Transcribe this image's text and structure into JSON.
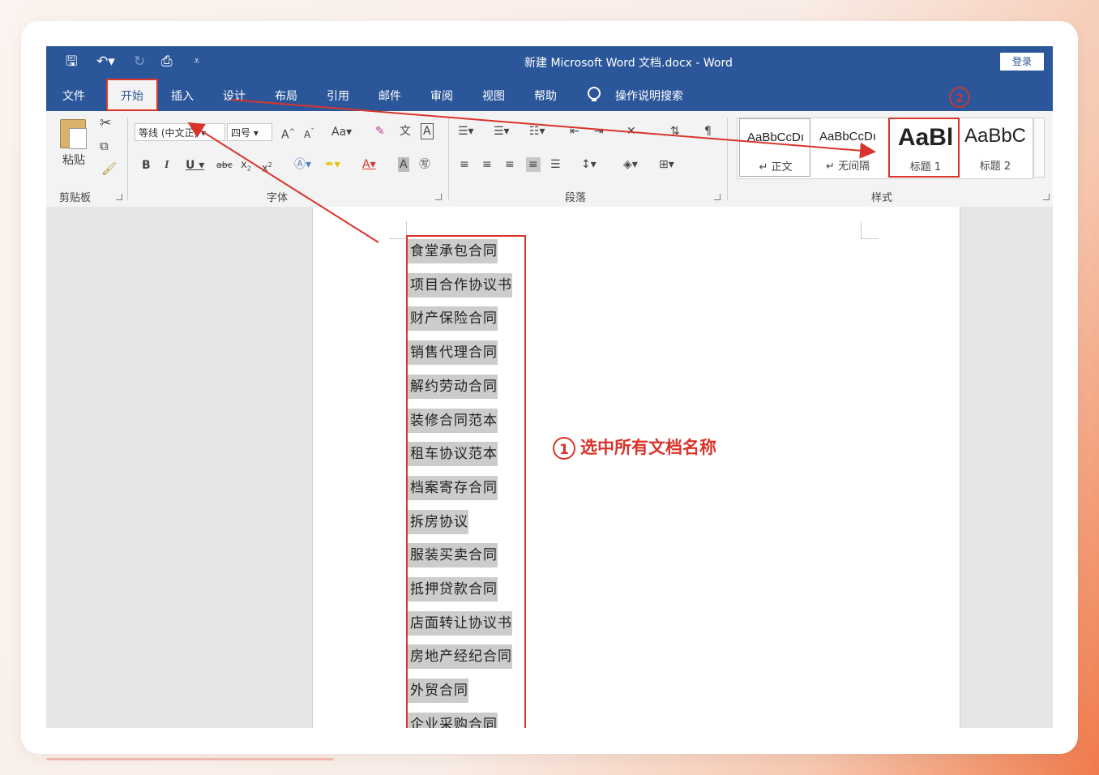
{
  "window": {
    "title": "新建 Microsoft Word 文档.docx  -  Word",
    "login": "登录"
  },
  "tabs": [
    "文件",
    "开始",
    "插入",
    "设计",
    "布局",
    "引用",
    "邮件",
    "审阅",
    "视图",
    "帮助"
  ],
  "tell_me": "操作说明搜索",
  "ribbon": {
    "clipboard": {
      "paste": "粘贴",
      "label": "剪贴板"
    },
    "font": {
      "font_name": "等线 (中文正)",
      "font_size": "四号",
      "label": "字体",
      "change_case": "Aa"
    },
    "paragraph": {
      "label": "段落"
    },
    "styles": {
      "label": "样式",
      "items": [
        {
          "preview": "AaBbCcDı",
          "name": "↵ 正文"
        },
        {
          "preview": "AaBbCcDı",
          "name": "↵ 无间隔"
        },
        {
          "preview": "AaBl",
          "name": "标题 1"
        },
        {
          "preview": "AaBbC",
          "name": "标题 2"
        }
      ]
    }
  },
  "document": {
    "lines": [
      "食堂承包合同",
      "项目合作协议书",
      "财产保险合同",
      "销售代理合同",
      "解约劳动合同",
      "装修合同范本",
      "租车协议范本",
      "档案寄存合同",
      "拆房协议",
      "服装买卖合同",
      "抵押贷款合同",
      "店面转让协议书",
      "房地产经纪合同",
      "外贸合同",
      "企业采购合同"
    ]
  },
  "annotations": {
    "step1_number": "1",
    "step1_text": "选中所有文档名称",
    "step2_number": "2"
  },
  "colors": {
    "word_blue": "#2b579a",
    "annotation_red": "#d9342b",
    "selection_gray": "#cccccc"
  }
}
